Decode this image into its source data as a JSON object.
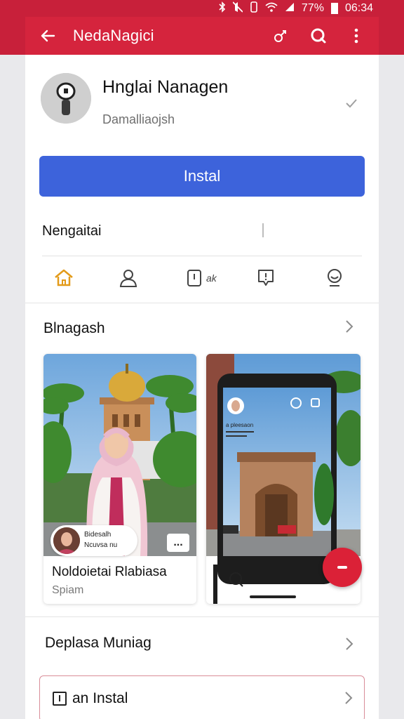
{
  "colors": {
    "app_bar": "#d5243d",
    "install_button": "#3d63db",
    "fab": "#db2137",
    "outline_row_border": "#d98c98"
  },
  "status_bar": {
    "battery": "77%",
    "time": "06:34",
    "icons": [
      "bluetooth-icon",
      "mute-icon",
      "vibrate-icon",
      "wifi-icon",
      "signal-icon",
      "battery-icon"
    ]
  },
  "app_bar": {
    "title": "NedaNagici",
    "icons": [
      "back-arrow-icon",
      "share-icon",
      "search-icon",
      "more-vert-icon"
    ]
  },
  "app": {
    "name": "Hnglai Nanagen",
    "developer": "Damalliaojsh",
    "check_icon": "check-icon"
  },
  "install_button": {
    "label": "Instal"
  },
  "section": {
    "label": "Nengaitai"
  },
  "tabs": [
    {
      "icon": "home-icon",
      "label": ""
    },
    {
      "icon": "person-icon",
      "label": ""
    },
    {
      "icon": "info-box-icon",
      "label": "ak"
    },
    {
      "icon": "alert-icon",
      "label": ""
    },
    {
      "icon": "smiley-icon",
      "label": ""
    }
  ],
  "gallery": {
    "title": "Blnagash",
    "screenshot1": {
      "chip_line1": "Bidesalh",
      "chip_line2": "Ncuvsa nu",
      "more": "...",
      "title": "Noldoietai Rlabiasa",
      "subtitle": "Spiam"
    },
    "screenshot2": {
      "notes": "a pleesaon",
      "fab_icon": "minus-icon"
    }
  },
  "rows": [
    {
      "label": "Deplasa Muniag"
    }
  ],
  "install_row": {
    "label": "an Instal"
  }
}
